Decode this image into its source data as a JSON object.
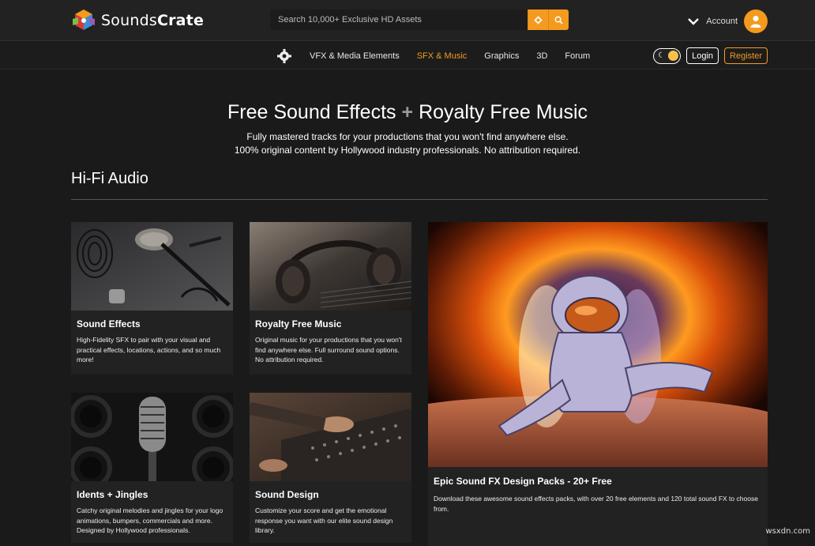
{
  "brand": {
    "name_regular": "Sounds",
    "name_bold": "Crate"
  },
  "search": {
    "placeholder": "Search 10,000+ Exclusive HD Assets",
    "settings_icon": "gear-icon",
    "search_icon": "search-icon"
  },
  "account": {
    "label": "Account"
  },
  "nav": {
    "items": [
      {
        "label": "VFX & Media Elements",
        "active": false
      },
      {
        "label": "SFX & Music",
        "active": true
      },
      {
        "label": "Graphics",
        "active": false
      },
      {
        "label": "3D",
        "active": false
      },
      {
        "label": "Forum",
        "active": false
      }
    ],
    "login_label": "Login",
    "register_label": "Register"
  },
  "hero": {
    "title_left": "Free Sound Effects",
    "title_plus": "+",
    "title_right": "Royalty Free Music",
    "subtitle_line1": "Fully mastered tracks for your productions that you won't find anywhere else.",
    "subtitle_line2": "100% original content by Hollywood industry professionals. No attribution required."
  },
  "section": {
    "title": "Hi-Fi Audio"
  },
  "cards": [
    {
      "title": "Sound Effects",
      "desc": "High-Fidelity SFX to pair with your visual and practical effects, locations, actions, and so much more!"
    },
    {
      "title": "Royalty Free Music",
      "desc": "Original music for your productions that you won't find anywhere else. Full surround sound options. No attribution required."
    },
    {
      "title": "Idents + Jingles",
      "desc": "Catchy original melodies and jingles for your logo animations, bumpers, commercials and more. Designed by Hollywood professionals."
    },
    {
      "title": "Sound Design",
      "desc": "Customize your score and get the emotional response you want with our elite sound design library."
    },
    {
      "title": "Epic Sound FX Design Packs - 20+ Free",
      "desc": "Download these awesome sound effects packs, with over 20 free elements and 120 total sound FX to choose from."
    }
  ],
  "watermark": "wsxdn.com",
  "colors": {
    "accent": "#f39a1f",
    "background": "#1a1a1a",
    "header": "#222222"
  }
}
